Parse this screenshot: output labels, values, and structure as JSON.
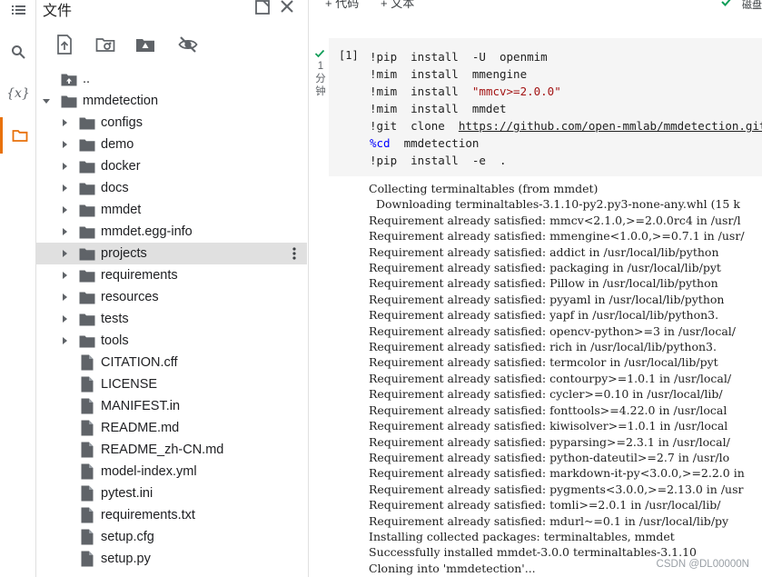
{
  "panel": {
    "title": "文件"
  },
  "tree": {
    "parent": "..",
    "root": "mmdetection",
    "folders": [
      "configs",
      "demo",
      "docker",
      "docs",
      "mmdet",
      "mmdet.egg-info",
      "projects",
      "requirements",
      "resources",
      "tests",
      "tools"
    ],
    "selected_folder": "projects",
    "files": [
      "CITATION.cff",
      "LICENSE",
      "MANIFEST.in",
      "README.md",
      "README_zh-CN.md",
      "model-index.yml",
      "pytest.ini",
      "requirements.txt",
      "setup.cfg",
      "setup.py"
    ]
  },
  "topbar": {
    "code_label": "+ 代码",
    "text_label": "+ 文本",
    "disk_label": "磁盘"
  },
  "cell": {
    "exec_count": "[1]",
    "exec_time": "1\n分\n钟",
    "lines": [
      {
        "parts": [
          {
            "t": "!pip  install  -U  openmim",
            "c": ""
          }
        ]
      },
      {
        "parts": [
          {
            "t": "!mim  install  mmengine",
            "c": ""
          }
        ]
      },
      {
        "parts": [
          {
            "t": "!mim  install  ",
            "c": ""
          },
          {
            "t": "\"mmcv>=2.0.0\"",
            "c": "str"
          }
        ]
      },
      {
        "parts": [
          {
            "t": "!mim  install  mmdet",
            "c": ""
          }
        ]
      },
      {
        "parts": [
          {
            "t": "!git  clone  ",
            "c": ""
          },
          {
            "t": "https://github.com/open-mmlab/mmdetection.git",
            "c": "url"
          }
        ]
      },
      {
        "parts": [
          {
            "t": "%cd",
            "c": "magic"
          },
          {
            "t": "  mmdetection",
            "c": ""
          }
        ]
      },
      {
        "parts": [
          {
            "t": "!pip  install  -e  .",
            "c": ""
          }
        ]
      }
    ],
    "output": [
      "Collecting terminaltables (from mmdet)",
      "  Downloading terminaltables-3.1.10-py2.py3-none-any.whl (15 k",
      "Requirement already satisfied: mmcv<2.1.0,>=2.0.0rc4 in /usr/l",
      "Requirement already satisfied: mmengine<1.0.0,>=0.7.1 in /usr/",
      "Requirement already satisfied: addict in /usr/local/lib/python",
      "Requirement already satisfied: packaging in /usr/local/lib/pyt",
      "Requirement already satisfied: Pillow in /usr/local/lib/python",
      "Requirement already satisfied: pyyaml in /usr/local/lib/python",
      "Requirement already satisfied: yapf in /usr/local/lib/python3.",
      "Requirement already satisfied: opencv-python>=3 in /usr/local/",
      "Requirement already satisfied: rich in /usr/local/lib/python3.",
      "Requirement already satisfied: termcolor in /usr/local/lib/pyt",
      "Requirement already satisfied: contourpy>=1.0.1 in /usr/local/",
      "Requirement already satisfied: cycler>=0.10 in /usr/local/lib/",
      "Requirement already satisfied: fonttools>=4.22.0 in /usr/local",
      "Requirement already satisfied: kiwisolver>=1.0.1 in /usr/local",
      "Requirement already satisfied: pyparsing>=2.3.1 in /usr/local/",
      "Requirement already satisfied: python-dateutil>=2.7 in /usr/lo",
      "Requirement already satisfied: markdown-it-py<3.0.0,>=2.2.0 in",
      "Requirement already satisfied: pygments<3.0.0,>=2.13.0 in /usr",
      "Requirement already satisfied: tomli>=2.0.1 in /usr/local/lib/",
      "Requirement already satisfied: mdurl~=0.1 in /usr/local/lib/py",
      "Installing collected packages: terminaltables, mmdet",
      "Successfully installed mmdet-3.0.0 terminaltables-3.1.10",
      "Cloning into 'mmdetection'..."
    ]
  },
  "watermark": "CSDN @DL00000N",
  "colors": {
    "accent": "#e8710a",
    "success": "#0f9d58",
    "folder": "#5f6368",
    "selected_row": "#e0e0e0"
  }
}
